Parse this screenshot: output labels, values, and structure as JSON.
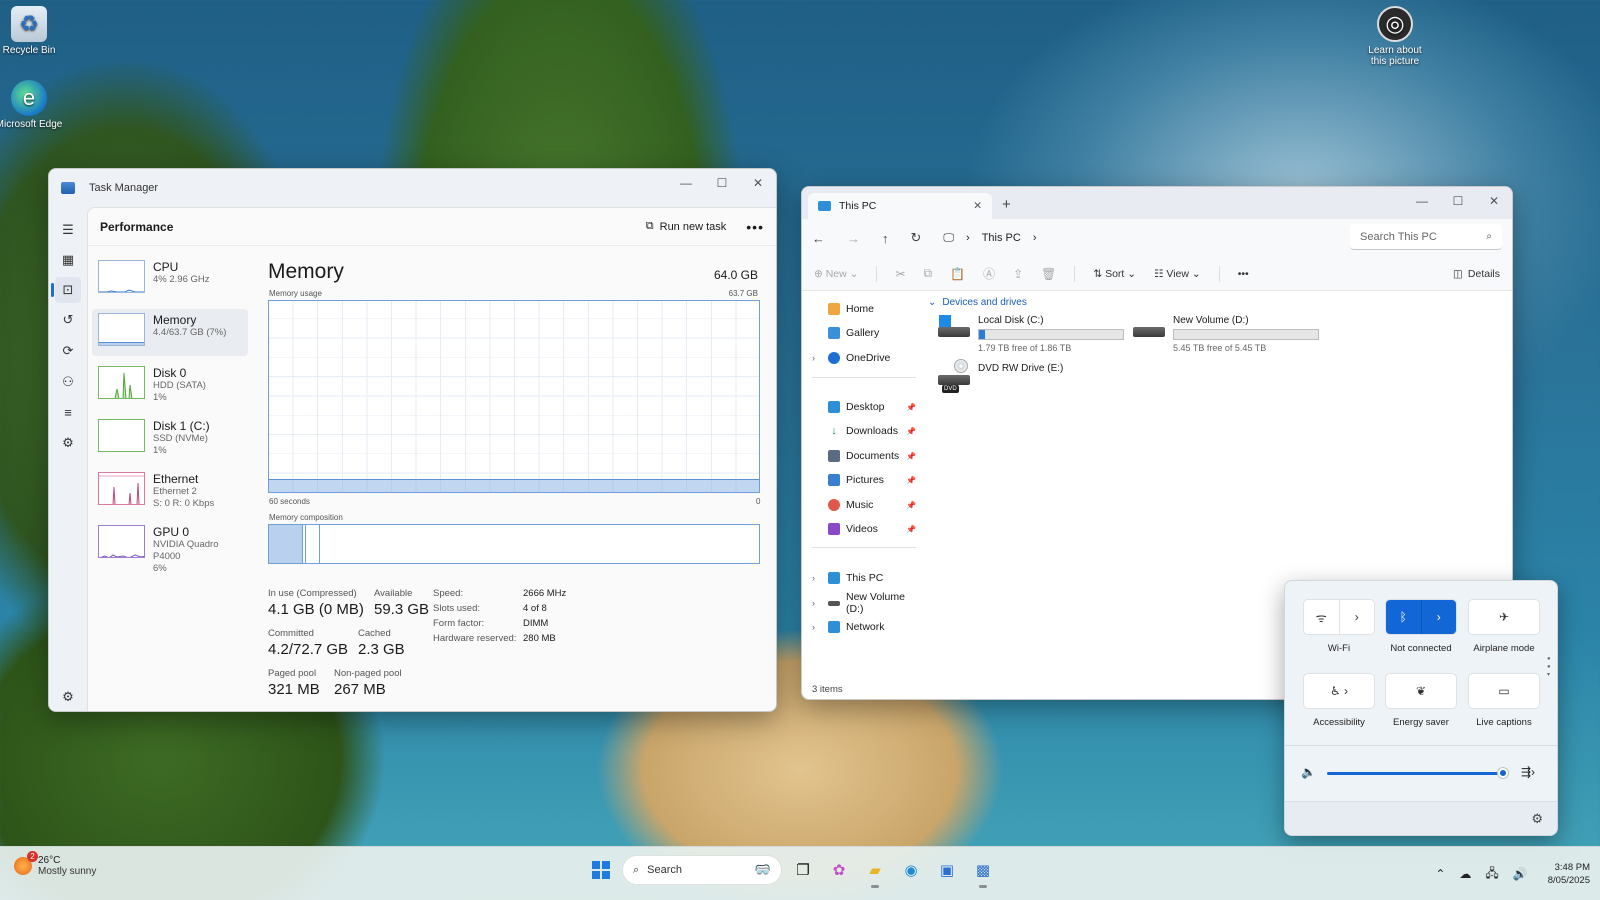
{
  "desktop": {
    "icons": [
      {
        "label": "Recycle Bin"
      },
      {
        "label": "Microsoft Edge"
      },
      {
        "label": "Learn about this picture"
      }
    ]
  },
  "taskmgr": {
    "window_title": "Task Manager",
    "section_title": "Performance",
    "run_task_label": "Run new task",
    "perf_items": [
      {
        "name": "CPU",
        "sub1": "4% 2.96 GHz",
        "sub2": ""
      },
      {
        "name": "Memory",
        "sub1": "4.4/63.7 GB (7%)",
        "sub2": ""
      },
      {
        "name": "Disk 0",
        "sub1": "HDD (SATA)",
        "sub2": "1%"
      },
      {
        "name": "Disk 1 (C:)",
        "sub1": "SSD (NVMe)",
        "sub2": "1%"
      },
      {
        "name": "Ethernet",
        "sub1": "Ethernet 2",
        "sub2": "S: 0 R: 0 Kbps"
      },
      {
        "name": "GPU 0",
        "sub1": "NVIDIA Quadro P4000",
        "sub2": "6%"
      }
    ],
    "memory": {
      "title": "Memory",
      "total": "64.0 GB",
      "usage_label": "Memory usage",
      "usage_max": "63.7 GB",
      "axis_left": "60 seconds",
      "axis_right": "0",
      "usage_fraction": 0.07,
      "composition_label": "Memory composition",
      "stats": {
        "in_use_k": "In use (Compressed)",
        "in_use_v": "4.1 GB (0 MB)",
        "available_k": "Available",
        "available_v": "59.3 GB",
        "committed_k": "Committed",
        "committed_v": "4.2/72.7 GB",
        "cached_k": "Cached",
        "cached_v": "2.3 GB",
        "paged_k": "Paged pool",
        "paged_v": "321 MB",
        "nonpaged_k": "Non-paged pool",
        "nonpaged_v": "267 MB"
      },
      "specs": [
        {
          "k": "Speed:",
          "v": "2666 MHz"
        },
        {
          "k": "Slots used:",
          "v": "4 of 8"
        },
        {
          "k": "Form factor:",
          "v": "DIMM"
        },
        {
          "k": "Hardware reserved:",
          "v": "280 MB"
        }
      ]
    }
  },
  "explorer": {
    "tab_title": "This PC",
    "breadcrumb": "This PC",
    "search_placeholder": "Search This PC",
    "cmd": {
      "new": "New",
      "sort": "Sort",
      "view": "View",
      "details": "Details"
    },
    "nav": {
      "home": "Home",
      "gallery": "Gallery",
      "onedrive": "OneDrive",
      "desktop": "Desktop",
      "downloads": "Downloads",
      "documents": "Documents",
      "pictures": "Pictures",
      "music": "Music",
      "videos": "Videos",
      "thispc": "This PC",
      "newvolume": "New Volume (D:)",
      "network": "Network"
    },
    "group_header": "Devices and drives",
    "drives": [
      {
        "name": "Local Disk (C:)",
        "free": "1.79 TB free of 1.86 TB",
        "used_fraction": 0.04
      },
      {
        "name": "New Volume (D:)",
        "free": "5.45 TB free of 5.45 TB",
        "used_fraction": 0.0
      },
      {
        "name": "DVD RW Drive (E:)",
        "badge": "DVD"
      }
    ],
    "status": "3 items"
  },
  "quick_settings": {
    "wifi": "Wi-Fi",
    "bluetooth": "Not connected",
    "airplane": "Airplane mode",
    "accessibility": "Accessibility",
    "energy": "Energy saver",
    "captions": "Live captions",
    "volume_fraction": 0.98
  },
  "taskbar": {
    "weather_temp": "26°C",
    "weather_desc": "Mostly sunny",
    "weather_badge": "2",
    "search_label": "Search",
    "time": "3:48 PM",
    "date": "8/05/2025"
  }
}
